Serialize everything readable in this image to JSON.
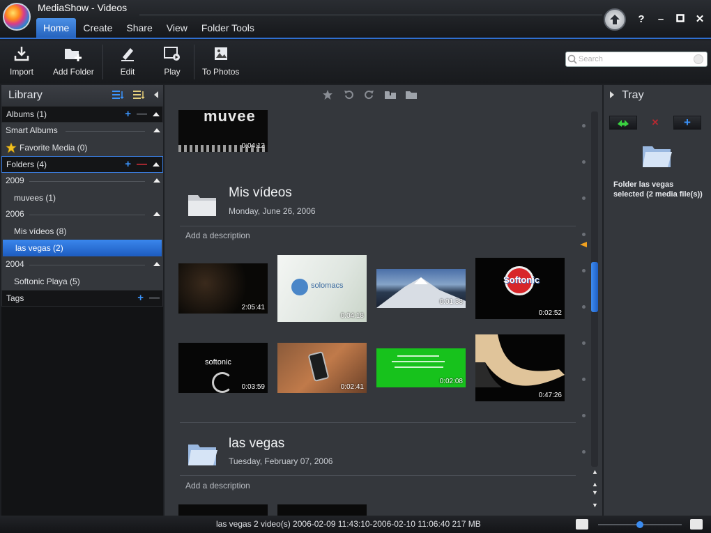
{
  "app": {
    "title": "MediaShow - Videos",
    "tabs": [
      "Home",
      "Create",
      "Share",
      "View",
      "Folder Tools"
    ],
    "active_tab": "Home"
  },
  "toolbar": {
    "import": "Import",
    "add_folder": "Add Folder",
    "edit": "Edit",
    "play": "Play",
    "to_photos": "To Photos",
    "search_placeholder": "Search"
  },
  "library": {
    "title": "Library",
    "albums": "Albums (1)",
    "smart_albums": "Smart Albums",
    "favorite_media": "Favorite Media (0)",
    "folders": "Folders (4)",
    "year_2009": "2009",
    "muvees": "muvees (1)",
    "year_2006": "2006",
    "mis_videos": "Mis vídeos (8)",
    "las_vegas": "las vegas (2)",
    "year_2004": "2004",
    "softonic_playa": "Softonic Playa (5)",
    "tags": "Tags"
  },
  "center": {
    "top_clip": {
      "title": "muvee",
      "duration": "0:04:12"
    },
    "group1": {
      "title": "Mis vídeos",
      "date": "Monday, June 26, 2006",
      "description": "Add a description",
      "clips": [
        {
          "duration": "2:05:41"
        },
        {
          "duration": "0:04:18",
          "label": "solomacs"
        },
        {
          "duration": "0:01:38"
        },
        {
          "duration": "0:02:52",
          "label": "Softonic"
        },
        {
          "duration": "0:03:59",
          "label": "softonic"
        },
        {
          "duration": "0:02:41"
        },
        {
          "duration": "0:02:08"
        },
        {
          "duration": "0:47:26"
        }
      ]
    },
    "group2": {
      "title": "las vegas",
      "date": "Tuesday, February 07, 2006",
      "description": "Add a description"
    }
  },
  "tray": {
    "title": "Tray",
    "info": "Folder las vegas selected (2 media file(s))"
  },
  "status": {
    "text": "las vegas  2 video(s)  2006-02-09 11:43:10-2006-02-10 11:06:40  217 MB",
    "zoom": 0.5
  },
  "colors": {
    "accent": "#2f6fd0",
    "selection": "#3a86ec",
    "panel": "#34373c"
  }
}
